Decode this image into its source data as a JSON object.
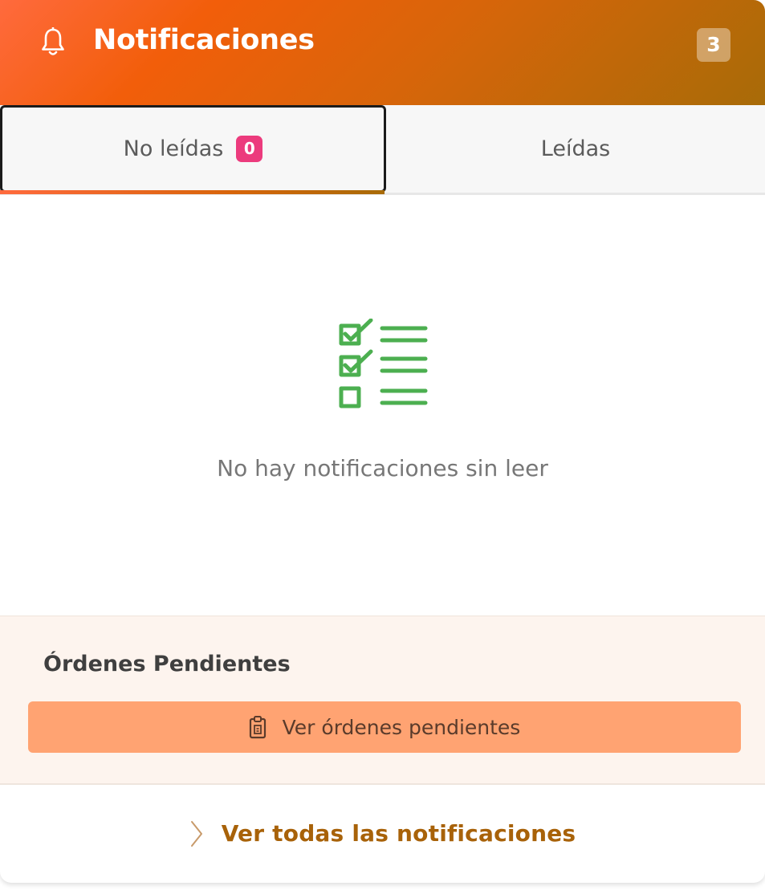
{
  "header": {
    "title": "Notificaciones",
    "count": "3",
    "icon": "bell-icon"
  },
  "tabs": [
    {
      "label": "No leídas",
      "badge": "0",
      "active": true
    },
    {
      "label": "Leídas",
      "active": false
    }
  ],
  "empty_state": {
    "icon": "checklist-icon",
    "message": "No hay notificaciones sin leer"
  },
  "pending_orders": {
    "title": "Órdenes Pendientes",
    "button_label": "Ver órdenes pendientes",
    "button_icon": "clipboard-icon"
  },
  "footer": {
    "link_label": "Ver todas las notificaciones",
    "link_icon": "chevron-right-icon"
  },
  "colors": {
    "header_gradient_start": "#ff6a3d",
    "header_gradient_end": "#a86b08",
    "tab_badge": "#ec3b7d",
    "checklist_green": "#4caf50",
    "pending_button": "#ffa372",
    "footer_link": "#a86209"
  }
}
